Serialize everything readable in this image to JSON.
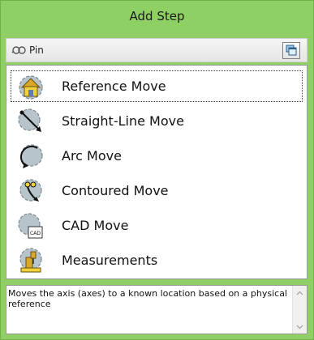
{
  "panel": {
    "title": "Add Step"
  },
  "toolbar": {
    "pin_label": "Pin",
    "pin_icon": "pin-icon",
    "dock_icon": "dock-window-icon"
  },
  "steps": {
    "items": [
      {
        "label": "Reference Move",
        "icon": "reference-move-icon",
        "selected": true
      },
      {
        "label": "Straight-Line Move",
        "icon": "straight-line-move-icon",
        "selected": false
      },
      {
        "label": "Arc Move",
        "icon": "arc-move-icon",
        "selected": false
      },
      {
        "label": "Contoured Move",
        "icon": "contoured-move-icon",
        "selected": false
      },
      {
        "label": "CAD Move",
        "icon": "cad-move-icon",
        "selected": false
      },
      {
        "label": "Measurements",
        "icon": "measurements-icon",
        "selected": false
      }
    ],
    "cad_badge": "CAD"
  },
  "description": {
    "text": "Moves the axis (axes) to a known location based on a physical reference"
  },
  "colors": {
    "panel_green": "#8fcf65",
    "gear_gray": "#b8c4cc",
    "house_yellow": "#f2d23a"
  }
}
